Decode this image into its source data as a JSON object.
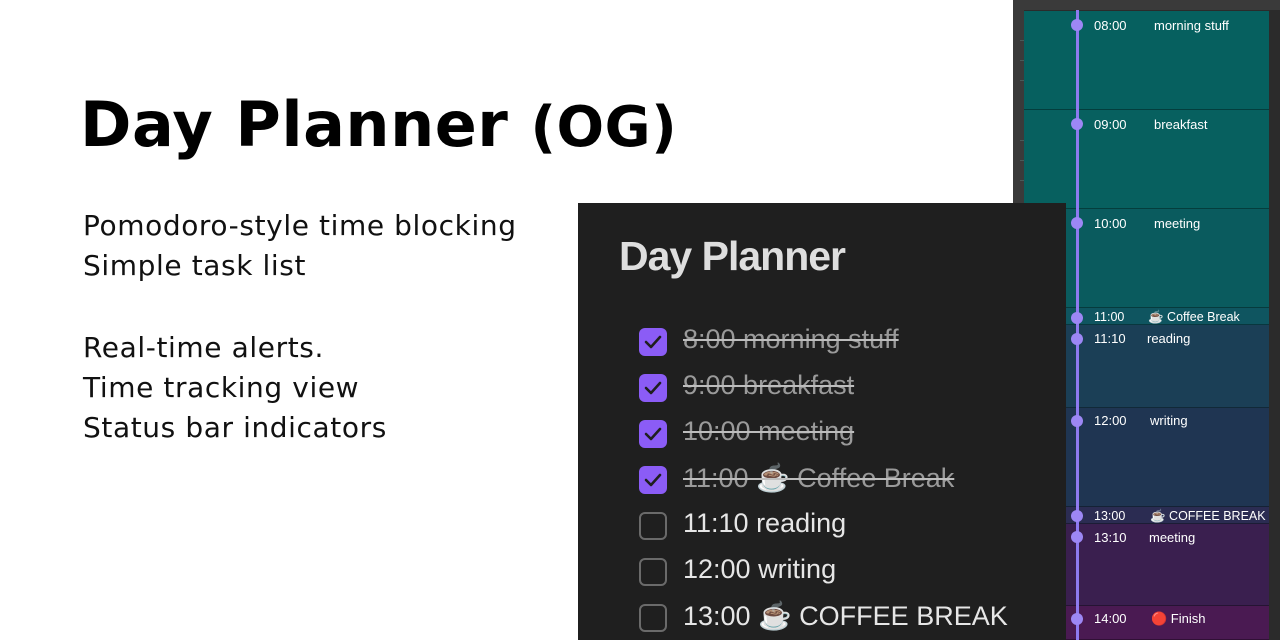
{
  "promo": {
    "title_main": "Day Planner",
    "title_suffix": "(OG)",
    "features": [
      "Pomodoro-style time blocking",
      "Simple task list",
      "Real-time alerts.",
      "Time tracking view",
      "Status bar indicators"
    ]
  },
  "planner": {
    "title": "Day Planner",
    "tasks": [
      {
        "text": "8:00 morning stuff",
        "done": true
      },
      {
        "text": "9:00 breakfast",
        "done": true
      },
      {
        "text": "10:00 meeting",
        "done": true
      },
      {
        "text": "11:00 ☕ Coffee Break",
        "done": true
      },
      {
        "text": "11:10 reading",
        "done": false
      },
      {
        "text": "12:00 writing",
        "done": false
      },
      {
        "text": "13:00 ☕ COFFEE BREAK",
        "done": false
      }
    ],
    "accent_color": "#8b5cf6"
  },
  "timeline": {
    "line_color": "#8e7af0",
    "blocks": [
      {
        "time": "08:00",
        "label": "morning stuff",
        "color": "#06605f"
      },
      {
        "time": "09:00",
        "label": "breakfast",
        "color": "#07605f"
      },
      {
        "time": "10:00",
        "label": "meeting",
        "color": "#0a5b5e"
      },
      {
        "time": "11:00",
        "label": "☕ Coffee Break",
        "color": "#0f5560"
      },
      {
        "time": "11:10",
        "label": "reading",
        "color": "#1b3f56"
      },
      {
        "time": "12:00",
        "label": "writing",
        "color": "#1f3552"
      },
      {
        "time": "13:00",
        "label": "☕ COFFEE BREAK",
        "color": "#2b2c52"
      },
      {
        "time": "13:10",
        "label": "meeting",
        "color": "#3a1f4f"
      },
      {
        "time": "14:00",
        "label": "🔴 Finish",
        "color": "#4a1a52"
      }
    ]
  }
}
